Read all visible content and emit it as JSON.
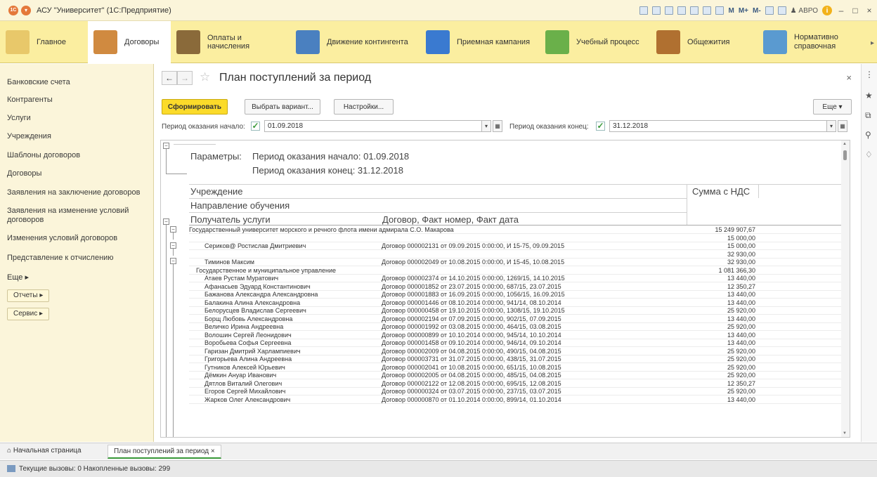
{
  "window": {
    "title": "АСУ \"Университет\" (1С:Предприятие)",
    "toolbar_labels": [
      "M",
      "M+",
      "M-"
    ],
    "user": "АВРО"
  },
  "sections": [
    {
      "label": "Главное",
      "color": "#e8c86a"
    },
    {
      "label": "Договоры",
      "color": "#d08a40"
    },
    {
      "label": "Оплаты и начисления",
      "color": "#8a6a3a"
    },
    {
      "label": "Движение контингента",
      "color": "#4a80c0"
    },
    {
      "label": "Приемная кампания",
      "color": "#3a7ad0"
    },
    {
      "label": "Учебный процесс",
      "color": "#6ab04a"
    },
    {
      "label": "Общежития",
      "color": "#b07030"
    },
    {
      "label": "Нормативно справочная информация",
      "color": "#5a9ad0"
    }
  ],
  "leftnav": {
    "items": [
      "Банковские счета",
      "Контрагенты",
      "Услуги",
      "Учреждения",
      "Шаблоны договоров",
      "Договоры",
      "Заявления на заключение договоров",
      "Заявления на изменение условий договоров",
      "Изменения условий договоров",
      "Представление к отчислению"
    ],
    "more": "Еще ▸",
    "reports_btn": "Отчеты ▸",
    "service_btn": "Сервис ▸"
  },
  "form": {
    "title": "План поступлений за период",
    "generate_btn": "Сформировать",
    "variant_btn": "Выбрать вариант...",
    "settings_btn": "Настройки...",
    "more_btn": "Еще ▾",
    "period_start_label": "Период оказания начало:",
    "period_start_value": "01.09.2018",
    "period_end_label": "Период оказания конец:",
    "period_end_value": "31.12.2018"
  },
  "report": {
    "params_title": "Параметры:",
    "params_line1": "Период оказания начало: 01.09.2018",
    "params_line2": "Период оказания конец: 31.12.2018",
    "col_institution": "Учреждение",
    "col_direction": "Направление обучения",
    "col_recipient": "Получатель услуги",
    "col_contract": "Договор, Факт номер, Факт дата",
    "col_sum": "Сумма с НДС",
    "rows": [
      {
        "c1": "Государственный университет морского и речного флота имени адмирала С.О. Макарова",
        "c2": "",
        "c3": "15 249 907,67",
        "indent": 0
      },
      {
        "c1": "",
        "c2": "",
        "c3": "15 000,00",
        "indent": 0
      },
      {
        "c1": "Сериков@ Ростислав Дмитриевич",
        "c2": "Договор 000002131 от 09.09.2015 0:00:00, И 15-75, 09.09.2015",
        "c3": "15 000,00",
        "indent": 2
      },
      {
        "c1": "",
        "c2": "",
        "c3": "32 930,00",
        "indent": 0
      },
      {
        "c1": "Тиминов Максим",
        "c2": "Договор 000002049 от 10.08.2015 0:00:00, И 15-45, 10.08.2015",
        "c3": "32 930,00",
        "indent": 2
      },
      {
        "c1": "Государственное и муниципальное управление",
        "c2": "",
        "c3": "1 081 366,30",
        "indent": 1
      },
      {
        "c1": "Атаев Рустам Муратович",
        "c2": "Договор 000002374 от 14.10.2015 0:00:00, 1269/15, 14.10.2015",
        "c3": "13 440,00",
        "indent": 2
      },
      {
        "c1": "Афанасьев Эдуард Константинович",
        "c2": "Договор 000001852 от 23.07.2015 0:00:00, 687/15, 23.07.2015",
        "c3": "12 350,27",
        "indent": 2
      },
      {
        "c1": "Бажанова Александра Александровна",
        "c2": "Договор 000001883 от 16.09.2015 0:00:00, 1056/15, 16.09.2015",
        "c3": "13 440,00",
        "indent": 2
      },
      {
        "c1": "Балакина Алина Александровна",
        "c2": "Договор 000001446 от 08.10.2014 0:00:00, 941/14, 08.10.2014",
        "c3": "13 440,00",
        "indent": 2
      },
      {
        "c1": "Белорусцев Владислав Сергеевич",
        "c2": "Договор 000000458 от 19.10.2015 0:00:00, 1308/15, 19.10.2015",
        "c3": "25 920,00",
        "indent": 2
      },
      {
        "c1": "Борщ Любовь Александровна",
        "c2": "Договор 000002194 от 07.09.2015 0:00:00, 902/15, 07.09.2015",
        "c3": "13 440,00",
        "indent": 2
      },
      {
        "c1": "Величко Ирина Андреевна",
        "c2": "Договор 000001992 от 03.08.2015 0:00:00, 464/15, 03.08.2015",
        "c3": "25 920,00",
        "indent": 2
      },
      {
        "c1": "Волошин Сергей Леонидович",
        "c2": "Договор 000000899 от 10.10.2014 0:00:00, 945/14, 10.10.2014",
        "c3": "13 440,00",
        "indent": 2
      },
      {
        "c1": "Воробьева Софья Сергеевна",
        "c2": "Договор 000001458 от 09.10.2014 0:00:00, 946/14, 09.10.2014",
        "c3": "13 440,00",
        "indent": 2
      },
      {
        "c1": "Гаризан Дмитрий Харлампиевич",
        "c2": "Договор 000002009 от 04.08.2015 0:00:00, 490/15, 04.08.2015",
        "c3": "25 920,00",
        "indent": 2
      },
      {
        "c1": "Григорьева Алина Андреевна",
        "c2": "Договор 000003731 от 31.07.2015 0:00:00, 438/15, 31.07.2015",
        "c3": "25 920,00",
        "indent": 2
      },
      {
        "c1": "Гутников Алексей Юрьевич",
        "c2": "Договор 000002041 от 10.08.2015 0:00:00, 651/15, 10.08.2015",
        "c3": "25 920,00",
        "indent": 2
      },
      {
        "c1": "Дёмкин Ануар Иванович",
        "c2": "Договор 000002005 от 04.08.2015 0:00:00, 485/15, 04.08.2015",
        "c3": "25 920,00",
        "indent": 2
      },
      {
        "c1": "Дятлов Виталий Олегович",
        "c2": "Договор 000002122 от 12.08.2015 0:00:00, 695/15, 12.08.2015",
        "c3": "12 350,27",
        "indent": 2
      },
      {
        "c1": "Егоров Сергей Михайлович",
        "c2": "Договор 000000324 от 03.07.2015 0:00:00, 237/15, 03.07.2015",
        "c3": "25 920,00",
        "indent": 2
      },
      {
        "c1": "Жарков Олег Александрович",
        "c2": "Договор 000000870 от 01.10.2014 0:00:00, 899/14, 01.10.2014",
        "c3": "13 440,00",
        "indent": 2
      }
    ]
  },
  "tabs": {
    "home": "Начальная страница",
    "open": "План поступлений за период ×"
  },
  "status": {
    "text": "Текущие вызовы: 0   Накопленные вызовы: 299"
  }
}
